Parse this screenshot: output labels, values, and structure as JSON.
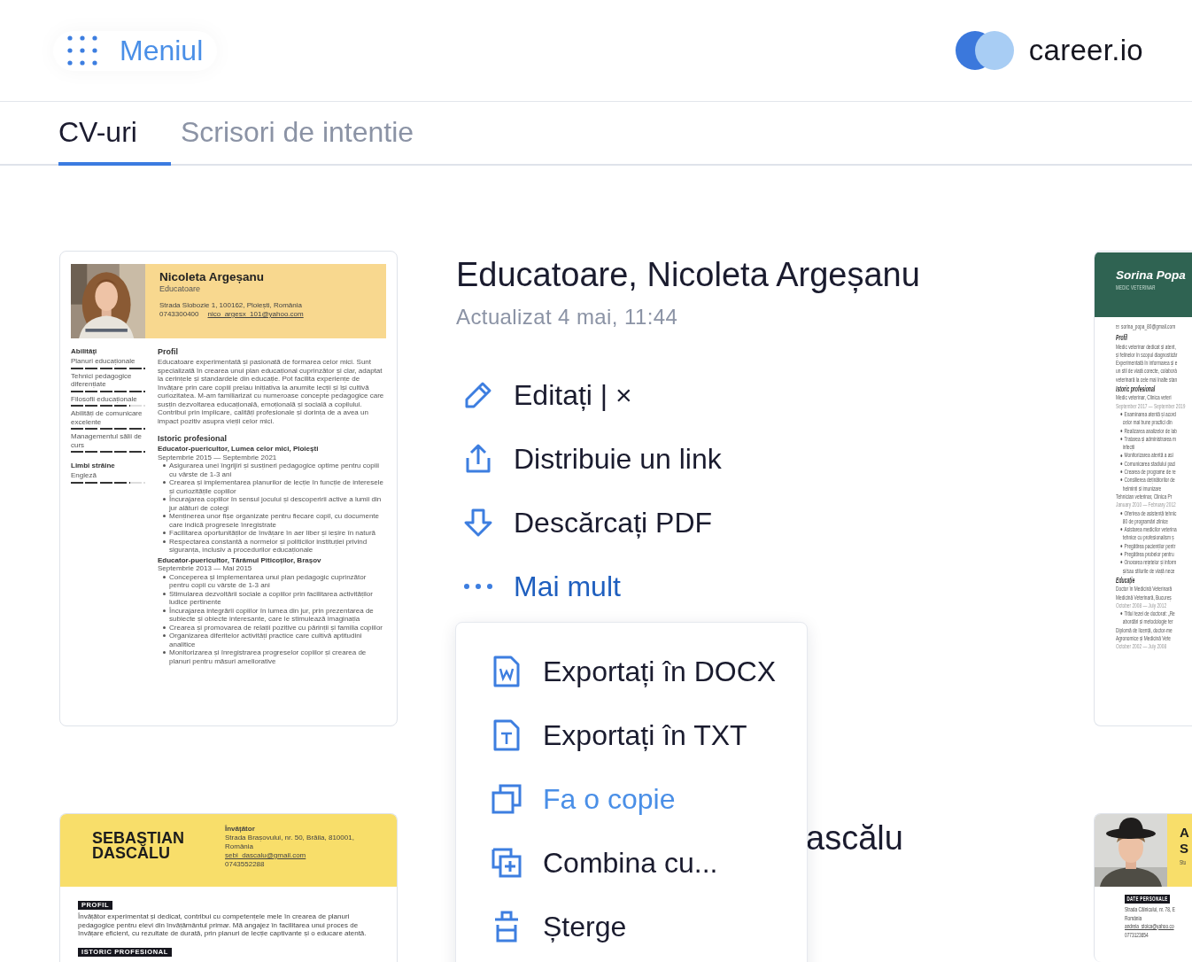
{
  "header": {
    "menu_label": "Meniul",
    "logo_text": "career.io"
  },
  "tabs": [
    {
      "label": "CV-uri",
      "selected": true
    },
    {
      "label": "Scrisori de intentie",
      "selected": false
    }
  ],
  "main": {
    "title": "Educatoare, Nicoleta Argeșanu",
    "updated": "Actualizat 4 mai, 11:44",
    "actions": [
      {
        "label": "Editați | ×",
        "kind": "action"
      },
      {
        "label": "Distribuie un link",
        "kind": "action"
      },
      {
        "label": "Descărcați PDF",
        "kind": "action"
      },
      {
        "label": "Mai mult",
        "kind": "more"
      }
    ],
    "menu": [
      {
        "label": "Exportați în DOCX",
        "selected": false
      },
      {
        "label": "Exportați în TXT",
        "selected": false
      },
      {
        "label": "Fa o copie",
        "selected": true
      },
      {
        "label": "Combina cu...",
        "selected": false
      },
      {
        "label": "Șterge",
        "selected": false
      }
    ],
    "preview": {
      "name": "Nicoleta Argeșanu",
      "role": "Educatoare",
      "address": "Strada Slobozie 1, 100162, Ploiești, România",
      "phone": "0743300400",
      "email": "nico_argesx_101@yahoo.com",
      "skills_heading": "Abilități",
      "skills": [
        {
          "name": "Planuri educaționale",
          "level": 1
        },
        {
          "name": "Tehnici pedagogice diferențiate",
          "level": 1
        },
        {
          "name": "Filosofii educaționale",
          "level": 0.8
        },
        {
          "name": "Abilități de comunicare excelente",
          "level": 1
        },
        {
          "name": "Managementul sălii de curs",
          "level": 1
        }
      ],
      "languages_heading": "Limbi străine",
      "languages": [
        {
          "name": "Engleză",
          "level": 0.8
        }
      ],
      "profile_heading": "Profil",
      "profile": "Educatoare experimentată și pasionată de formarea celor mici. Sunt specializată în crearea unui plan educațional cuprinzător și clar, adaptat la cerințele și standardele din educație. Pot facilita experiențe de învățare prin care copiii preiau inițiativa la anumite lecții și își cultivă curiozitatea. M-am familiarizat cu numeroase concepte pedagogice care susțin dezvoltarea educațională, emoțională și socială a copilului. Contribui prin implicare, calități profesionale și dorința de a avea un impact pozitiv asupra vieții celor mici.",
      "history_heading": "Istoric profesional",
      "jobs": [
        {
          "title": "Educator-puericultor, Lumea celor mici, Ploiești",
          "dates": "Septembrie 2015 — Septembrie 2021",
          "bullets": [
            "Asigurarea unei îngrijiri și susțineri pedagogice optime pentru copiii cu vârste de 1-3 ani",
            "Crearea și implementarea planurilor de lecție în funcție de interesele și curiozitățile copiilor",
            "Încurajarea copiilor în sensul jocului și descoperirii active a lumii din jur alături de colegi",
            "Menținerea unor fișe organizate pentru fiecare copil, cu documente care indică progresele înregistrate",
            "Facilitarea oportunităților de învățare în aer liber și ieșire în natură",
            "Respectarea constantă a normelor și politicilor instituției privind siguranța, inclusiv a procedurilor educaționale"
          ]
        },
        {
          "title": "Educator-puericultor, Tărâmul Piticoților, Brașov",
          "dates": "Septembrie 2013 — Mai 2015",
          "bullets": [
            "Conceperea și implementarea unui plan pedagogic cuprinzător pentru copii cu vârste de 1-3 ani",
            "Stimularea dezvoltării sociale a copiilor prin facilitarea activităților ludice pertinente",
            "Încurajarea integrării copiilor în lumea din jur, prin prezentarea de subiecte și obiecte interesante, care le stimulează imaginația",
            "Crearea și promovarea de relații pozitive cu părinții și familia copiilor",
            "Organizarea diferitelor activități practice care cultivă aptitudini analitice",
            "Monitorizarea și înregistrarea progreselor copiilor și crearea de planuri pentru măsuri ameliorative"
          ]
        }
      ]
    }
  },
  "second": {
    "title_visible": "ascălu",
    "preview": {
      "name_lines": [
        "SEBASTIAN",
        "DASCĂLU"
      ],
      "role": "Învățător",
      "address_lines": [
        "Strada Brașovului, nr. 50, Brăila, 810001,",
        "România"
      ],
      "email": "sebi_dascalu@gmail.com",
      "phone": "0743552288",
      "profile_heading": "PROFIL",
      "profile": "Învățător experimentat și dedicat, contribui cu competențele mele în crearea de planuri pedagogice pentru elevi din învățământul primar. Mă angajez în facilitarea unui proces de învățare eficient, cu rezultate de durată, prin planuri de lecție captivante și o educare atentă.",
      "history_heading": "ISTORIC PROFESIONAL"
    }
  },
  "side_top": {
    "name": "Sorina Popa",
    "role": "MEDIC VETERINAR",
    "lines": [
      {
        "kind": "contact",
        "text": "sorina_popa_80@gmail.com"
      },
      {
        "kind": "heading",
        "text": "Profil"
      },
      {
        "kind": "text",
        "text": "Medic veterinar dedicat și atent,"
      },
      {
        "kind": "text",
        "text": "și felinelor în scopul diagnosticăr"
      },
      {
        "kind": "text",
        "text": "Experimentată în informarea și e"
      },
      {
        "kind": "text",
        "text": "un stil de viață corecte, colaborâ"
      },
      {
        "kind": "text",
        "text": "veterinară la cele mai înalte stan"
      },
      {
        "kind": "heading",
        "text": "Istoric profesional"
      },
      {
        "kind": "text",
        "text": "Medic veterinar, Clinica veteri"
      },
      {
        "kind": "date",
        "text": "September 2017 — September 2019"
      },
      {
        "kind": "bullet",
        "text": "Examinarea atentă și acord"
      },
      {
        "kind": "cont",
        "text": "celor mai bune practici din"
      },
      {
        "kind": "bullet",
        "text": "Realizarea analizelor de lab"
      },
      {
        "kind": "bullet",
        "text": "Tratarea și administrarea m"
      },
      {
        "kind": "cont",
        "text": "infecții"
      },
      {
        "kind": "bullet",
        "text": "Monitorizarea atentă a asi"
      },
      {
        "kind": "bullet",
        "text": "Comunicarea stadiului paci"
      },
      {
        "kind": "bullet",
        "text": "Crearea de programe de re"
      },
      {
        "kind": "bullet",
        "text": "Consilierea deținătorilor de"
      },
      {
        "kind": "cont",
        "text": "helminți și imunizare"
      },
      {
        "kind": "text",
        "text": "Tehnician veterinar, Clinica Pr"
      },
      {
        "kind": "date",
        "text": "January 2010 — February 2012"
      },
      {
        "kind": "bullet",
        "text": "Oferirea de asistență tehnic"
      },
      {
        "kind": "cont",
        "text": "80 de programări zilnice"
      },
      {
        "kind": "bullet",
        "text": "Asistarea medicilor veterina"
      },
      {
        "kind": "cont",
        "text": "tehnice cu profesionalism ș"
      },
      {
        "kind": "bullet",
        "text": "Pregătirea pacienților pentr"
      },
      {
        "kind": "bullet",
        "text": "Pregătirea probelor pentru"
      },
      {
        "kind": "bullet",
        "text": "Onorarea rețetelor și inform"
      },
      {
        "kind": "cont",
        "text": "și/sau stilurile de viață nece"
      },
      {
        "kind": "heading",
        "text": "Educație"
      },
      {
        "kind": "text",
        "text": "Doctor în Medicină Veterinară"
      },
      {
        "kind": "text",
        "text": "Medicină Veterinară, Bucureș"
      },
      {
        "kind": "date",
        "text": "October 2008 — July 2012"
      },
      {
        "kind": "bullet",
        "text": "Titlul tezei de doctorat: „Re"
      },
      {
        "kind": "cont",
        "text": "abordări și metodologie ter"
      },
      {
        "kind": "text",
        "text": "Diplomă de licență, doctor-me"
      },
      {
        "kind": "text",
        "text": "Agronomice și Medicină Vete"
      },
      {
        "kind": "date",
        "text": "October 2002 — July 2008"
      }
    ]
  },
  "side_bottom": {
    "name_lines": [
      "A",
      "S"
    ],
    "role": "Stu",
    "section_heading": "DATE PERSONALE",
    "lines": [
      {
        "kind": "text",
        "text": "Strada Călnicului, nr. 78, E"
      },
      {
        "kind": "text",
        "text": "România"
      },
      {
        "kind": "link",
        "text": "andreia_stoica@yahoo.co"
      },
      {
        "kind": "text",
        "text": "0773123654"
      }
    ]
  }
}
